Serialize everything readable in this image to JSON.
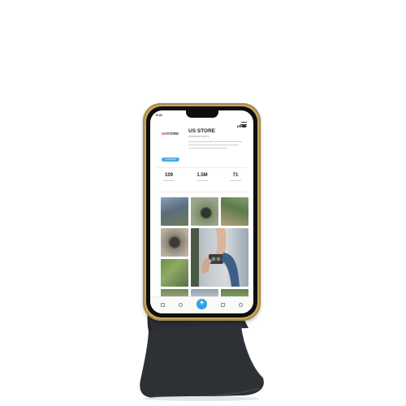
{
  "profile": {
    "status_time": "9:41",
    "logo_prefix": "US",
    "logo_suffix": "STORE",
    "store_name": "US STORE",
    "subtitle": "dealsstore.store",
    "follow_label": "FOLLOW"
  },
  "stats": [
    {
      "value": "109"
    },
    {
      "value": "1.5M"
    },
    {
      "value": "71"
    }
  ],
  "colors": {
    "accent": "#2fa3e6",
    "logo_red": "#d11f2b",
    "phone_frame": "#c9a85c",
    "stand": "#2a2d31"
  },
  "icons": [
    "home-icon",
    "search-icon",
    "plus-icon",
    "bag-icon",
    "profile-icon",
    "menu-icon"
  ]
}
